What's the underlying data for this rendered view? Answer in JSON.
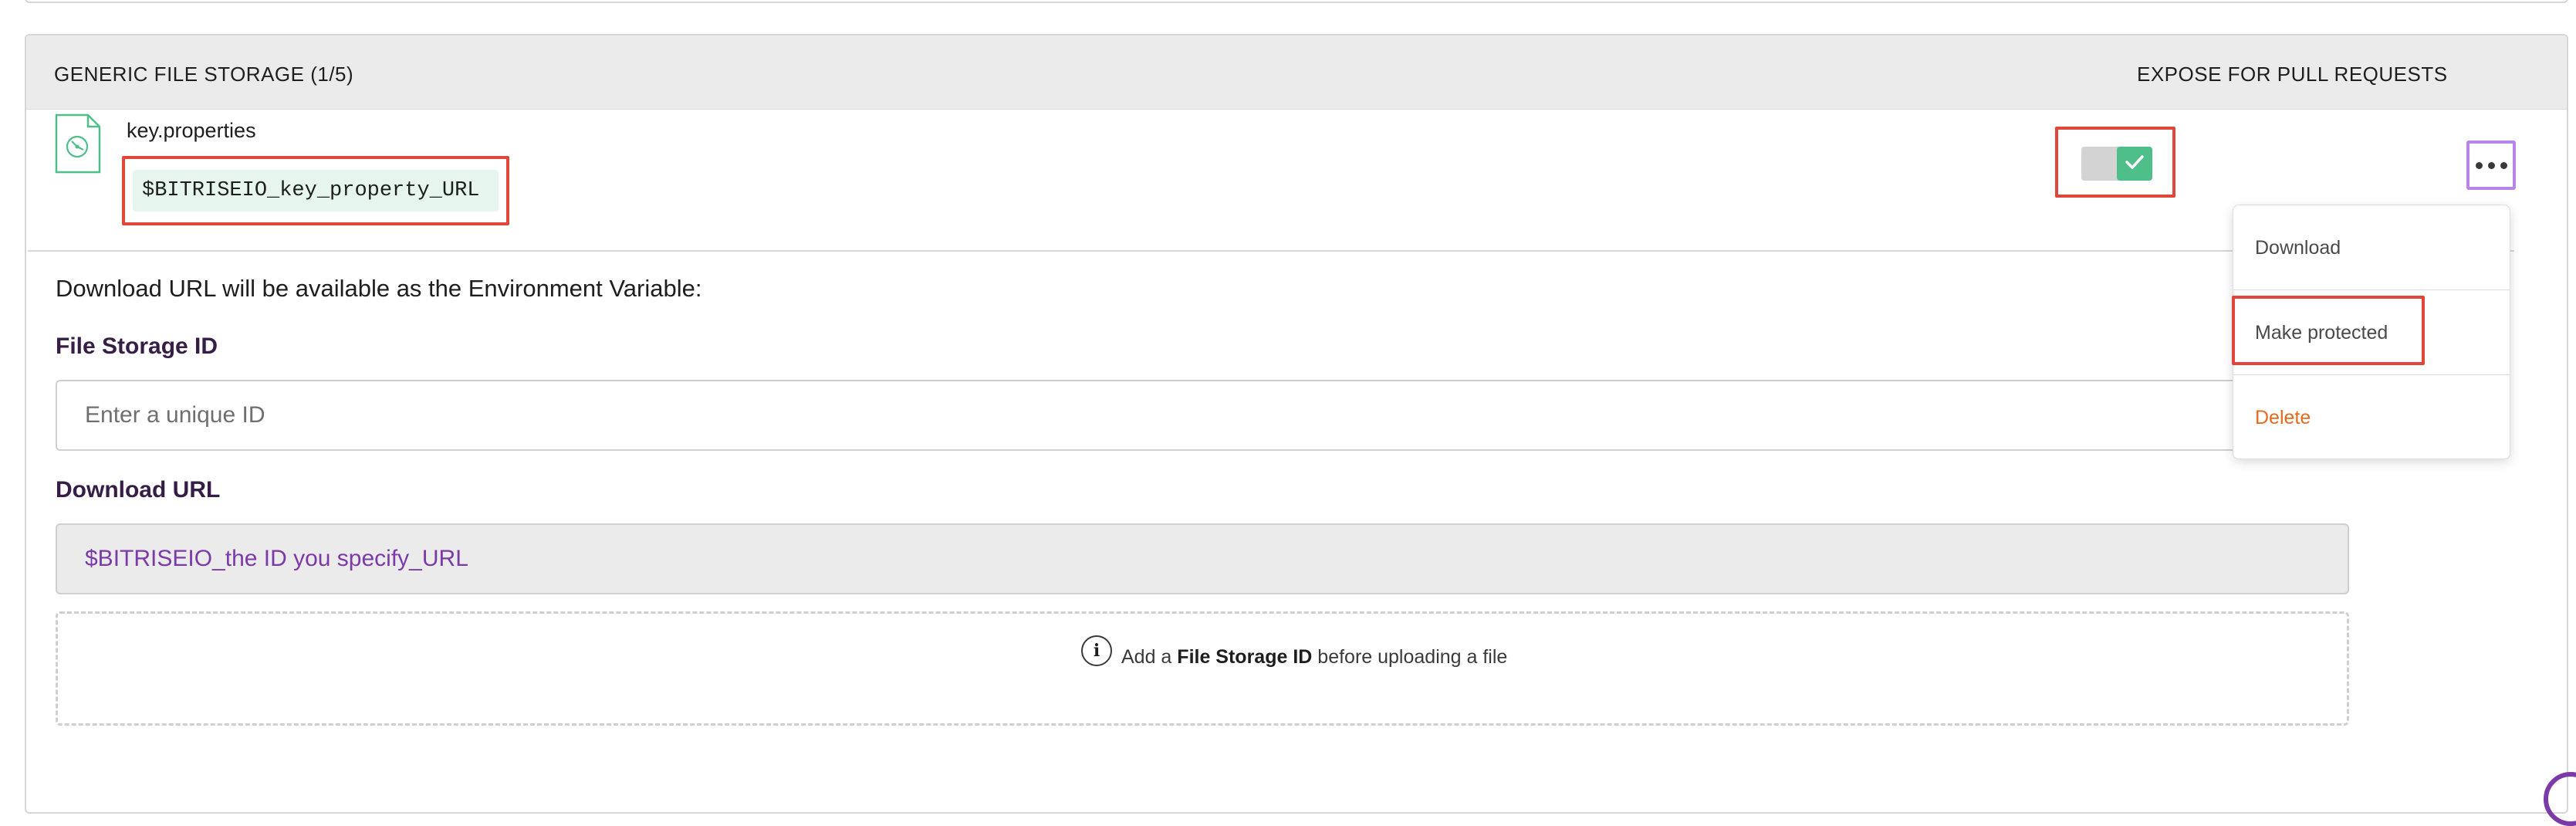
{
  "header": {
    "title": "GENERIC FILE STORAGE (1/5)",
    "expose_label": "EXPOSE FOR PULL REQUESTS"
  },
  "file": {
    "name": "key.properties",
    "env_variable": "$BITRISEIO_key_property_URL",
    "expose_for_pull_requests": true
  },
  "form": {
    "env_description": "Download URL will be available as the Environment Variable:",
    "file_storage_id_label": "File Storage ID",
    "file_storage_id_placeholder": "Enter a unique ID",
    "file_storage_id_value": "",
    "download_url_label": "Download URL",
    "download_url_value": "$BITRISEIO_the ID you specify_URL"
  },
  "dropzone": {
    "prefix": "Add a",
    "emphasis": "File Storage ID",
    "suffix": "before uploading a file"
  },
  "menu": {
    "items": [
      {
        "label": "Download"
      },
      {
        "label": "Make protected"
      },
      {
        "label": "Delete"
      }
    ]
  },
  "colors": {
    "accent_purple": "#7b3aa8",
    "toggle_green": "#4fbf8a",
    "danger_orange": "#e46b1e",
    "highlight_red": "#e0463a",
    "focus_lilac": "#b884e8"
  },
  "icons": {
    "file": "file-storage-icon",
    "check": "check-icon",
    "more": "more-dots-icon",
    "info": "info-icon"
  }
}
